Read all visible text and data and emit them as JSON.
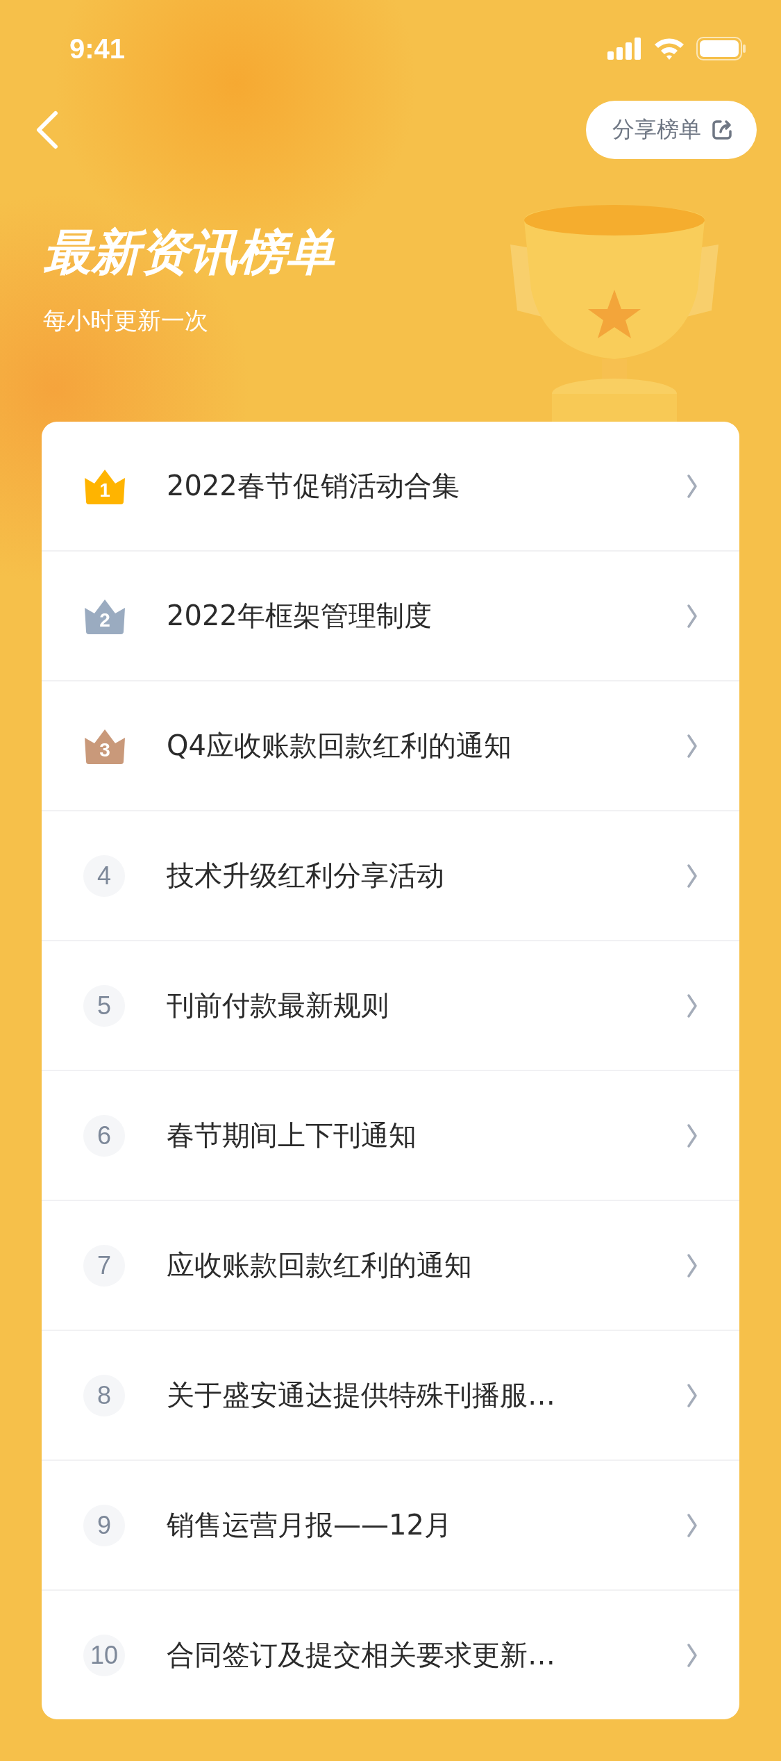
{
  "status_bar": {
    "time": "9:41"
  },
  "header": {
    "share_button": "分享榜单",
    "title": "最新资讯榜单",
    "subtitle": "每小时更新一次"
  },
  "ranking": [
    {
      "rank": "1",
      "kind": "crown",
      "color": "#ffb400",
      "title": "2022春节促销活动合集"
    },
    {
      "rank": "2",
      "kind": "crown",
      "color": "#9aabc0",
      "title": "2022年框架管理制度"
    },
    {
      "rank": "3",
      "kind": "crown",
      "color": "#c9997a",
      "title": "Q4应收账款回款红利的通知"
    },
    {
      "rank": "4",
      "kind": "plain",
      "title": "技术升级红利分享活动"
    },
    {
      "rank": "5",
      "kind": "plain",
      "title": "刊前付款最新规则"
    },
    {
      "rank": "6",
      "kind": "plain",
      "title": "春节期间上下刊通知"
    },
    {
      "rank": "7",
      "kind": "plain",
      "title": "应收账款回款红利的通知"
    },
    {
      "rank": "8",
      "kind": "plain",
      "title": "关于盛安通达提供特殊刊播服…"
    },
    {
      "rank": "9",
      "kind": "plain",
      "title": "销售运营月报——12月"
    },
    {
      "rank": "10",
      "kind": "plain",
      "title": "合同签订及提交相关要求更新…"
    }
  ]
}
